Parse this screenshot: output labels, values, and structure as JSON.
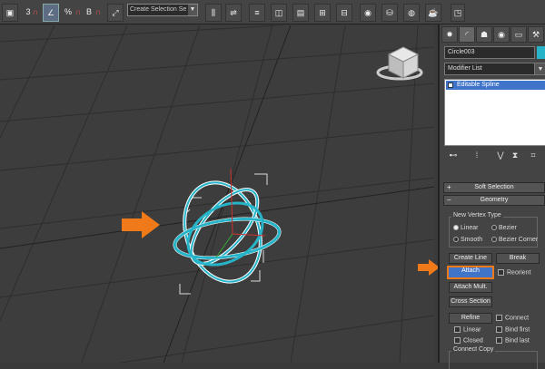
{
  "toolbar": {
    "buttons": [
      {
        "label": "▣",
        "name": "undo"
      },
      {
        "label": "3",
        "name": "snap-3d"
      },
      {
        "label": "∩",
        "name": "snap-magnet"
      },
      {
        "label": "∠",
        "name": "angle-snap"
      },
      {
        "label": "%",
        "name": "percent-snap"
      },
      {
        "label": "∩",
        "name": "spinner-snap"
      },
      {
        "label": "B",
        "name": "edit-named-selection"
      },
      {
        "label": "∩",
        "name": "named-sel-magnet"
      },
      {
        "label": "⤢",
        "name": "keyboard-shortcut"
      }
    ],
    "selection_set": "Create Selection Se",
    "right_buttons": [
      {
        "label": "⫼",
        "name": "mirror"
      },
      {
        "label": "⇌",
        "name": "align"
      },
      {
        "label": "≡",
        "name": "layer-manager"
      },
      {
        "label": "◫",
        "name": "scene-explorer"
      },
      {
        "label": "▤",
        "name": "graphite"
      },
      {
        "label": "⊞",
        "name": "curve-editor"
      },
      {
        "label": "⊟",
        "name": "schematic-view"
      },
      {
        "label": "◉",
        "name": "material-editor"
      },
      {
        "label": "⛁",
        "name": "render-setup"
      },
      {
        "label": "◍",
        "name": "rendered-frame"
      },
      {
        "label": "☕",
        "name": "render-production"
      }
    ]
  },
  "panel": {
    "tabs": [
      {
        "icon": "✸",
        "name": "create"
      },
      {
        "icon": "◜",
        "name": "modify"
      },
      {
        "icon": "☗",
        "name": "hierarchy"
      },
      {
        "icon": "◉",
        "name": "motion"
      },
      {
        "icon": "▭",
        "name": "display"
      },
      {
        "icon": "⚒",
        "name": "utilities"
      }
    ],
    "object_name": "Circle003",
    "object_color": "#27b4c9",
    "modifier_list": "Modifier List",
    "stack_item": "Editable Spline",
    "stack_tools": [
      "⊷",
      "⁞",
      "⋁",
      "⧗",
      "⌗"
    ]
  },
  "rollouts": {
    "soft_selection": "Soft Selection",
    "geometry": "Geometry",
    "new_vertex_type": "New Vertex Type",
    "radios": [
      {
        "label": "Linear",
        "on": true
      },
      {
        "label": "Bezier",
        "on": false
      },
      {
        "label": "Smooth",
        "on": false
      },
      {
        "label": "Bezier Corner",
        "on": false
      }
    ],
    "create_line": "Create Line",
    "break": "Break",
    "attach": "Attach",
    "reorient": "Reorient",
    "attach_mult": "Attach Mult.",
    "cross_section": "Cross Section",
    "refine": "Refine",
    "connect": "Connect",
    "linear": "Linear",
    "bind_first": "Bind first",
    "closed": "Closed",
    "bind_last": "Bind last",
    "connect_copy": "Connect Copy"
  },
  "colors": {
    "accent_arrow": "#f07a1a",
    "highlight": "#3f74c8",
    "object": "#27b4c9"
  }
}
